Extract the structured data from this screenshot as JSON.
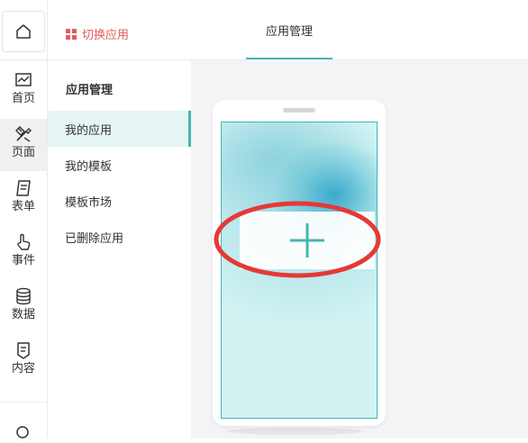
{
  "header": {
    "switch_app_label": "切换应用",
    "active_tab_label": "应用管理"
  },
  "rail": {
    "items": [
      {
        "label": "首页",
        "icon": "chart-icon"
      },
      {
        "label": "页面",
        "icon": "design-tools-icon"
      },
      {
        "label": "表单",
        "icon": "form-icon"
      },
      {
        "label": "事件",
        "icon": "touch-icon"
      },
      {
        "label": "数据",
        "icon": "database-icon"
      },
      {
        "label": "内容",
        "icon": "content-icon"
      }
    ],
    "active_index": 1
  },
  "subnav": {
    "title": "应用管理",
    "items": [
      "我的应用",
      "我的模板",
      "模板市场",
      "已删除应用"
    ],
    "active_index": 0
  },
  "colors": {
    "accent": "#43b5b2",
    "switch_app": "#e45c5c",
    "annotation": "#e53935"
  }
}
